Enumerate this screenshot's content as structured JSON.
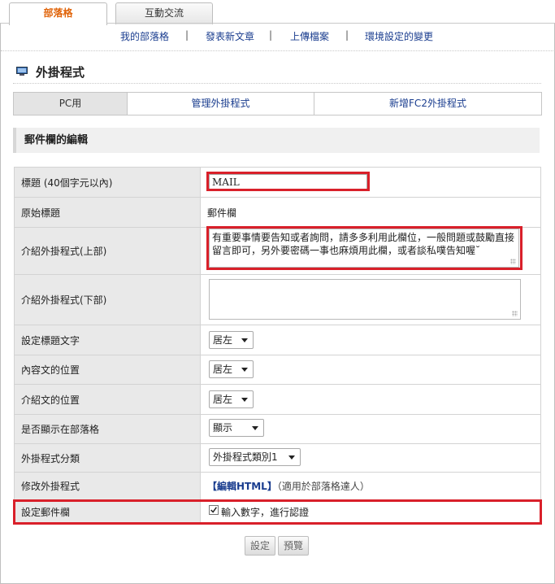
{
  "tabs": [
    {
      "label": "部落格",
      "active": true
    },
    {
      "label": "互動交流",
      "active": false
    }
  ],
  "subnav": [
    {
      "label": "我的部落格"
    },
    {
      "label": "發表新文章"
    },
    {
      "label": "上傳檔案"
    },
    {
      "label": "環境設定的變更"
    }
  ],
  "subnav_separator": "|",
  "page_title": "外掛程式",
  "page_title_icon": "monitor-icon",
  "subtabs": [
    {
      "label": "PC用",
      "active": true
    },
    {
      "label": "管理外掛程式",
      "active": false
    },
    {
      "label": "新增FC2外掛程式",
      "active": false
    }
  ],
  "section_title": "郵件欄的編輯",
  "form": {
    "title_label": "標題 (40個字元以內)",
    "title_value": "MAIL",
    "original_title_label": "原始標題",
    "original_title_value": "郵件欄",
    "intro_top_label": "介紹外掛程式(上部)",
    "intro_top_value": "有重要事情要告知或者詢問，請多多利用此欄位，一般問題或鼓勵直接留言即可，另外要密碼一事也麻煩用此欄，或者談私噗告知喔˘",
    "intro_bottom_label": "介紹外掛程式(下部)",
    "intro_bottom_value": "",
    "title_text_label": "設定標題文字",
    "title_text_value": "居左",
    "content_pos_label": "內容文的位置",
    "content_pos_value": "居左",
    "intro_pos_label": "介紹文的位置",
    "intro_pos_value": "居左",
    "display_label": "是否顯示在部落格",
    "display_value": "顯示",
    "category_label": "外掛程式分類",
    "category_value": "外掛程式類別1",
    "edit_label": "修改外掛程式",
    "edit_link": "【編輯HTML】",
    "edit_note": "（適用於部落格達人）",
    "mail_label": "設定郵件欄",
    "mail_checkbox_label": "輸入數字，進行認證",
    "mail_checkbox_checked": true
  },
  "buttons": {
    "submit": "設定",
    "preview": "預覽"
  },
  "colors": {
    "active_tab": "#e0640a",
    "link": "#1a3d8f",
    "highlight": "#d9202a",
    "label_bg": "#e9e9e9"
  }
}
